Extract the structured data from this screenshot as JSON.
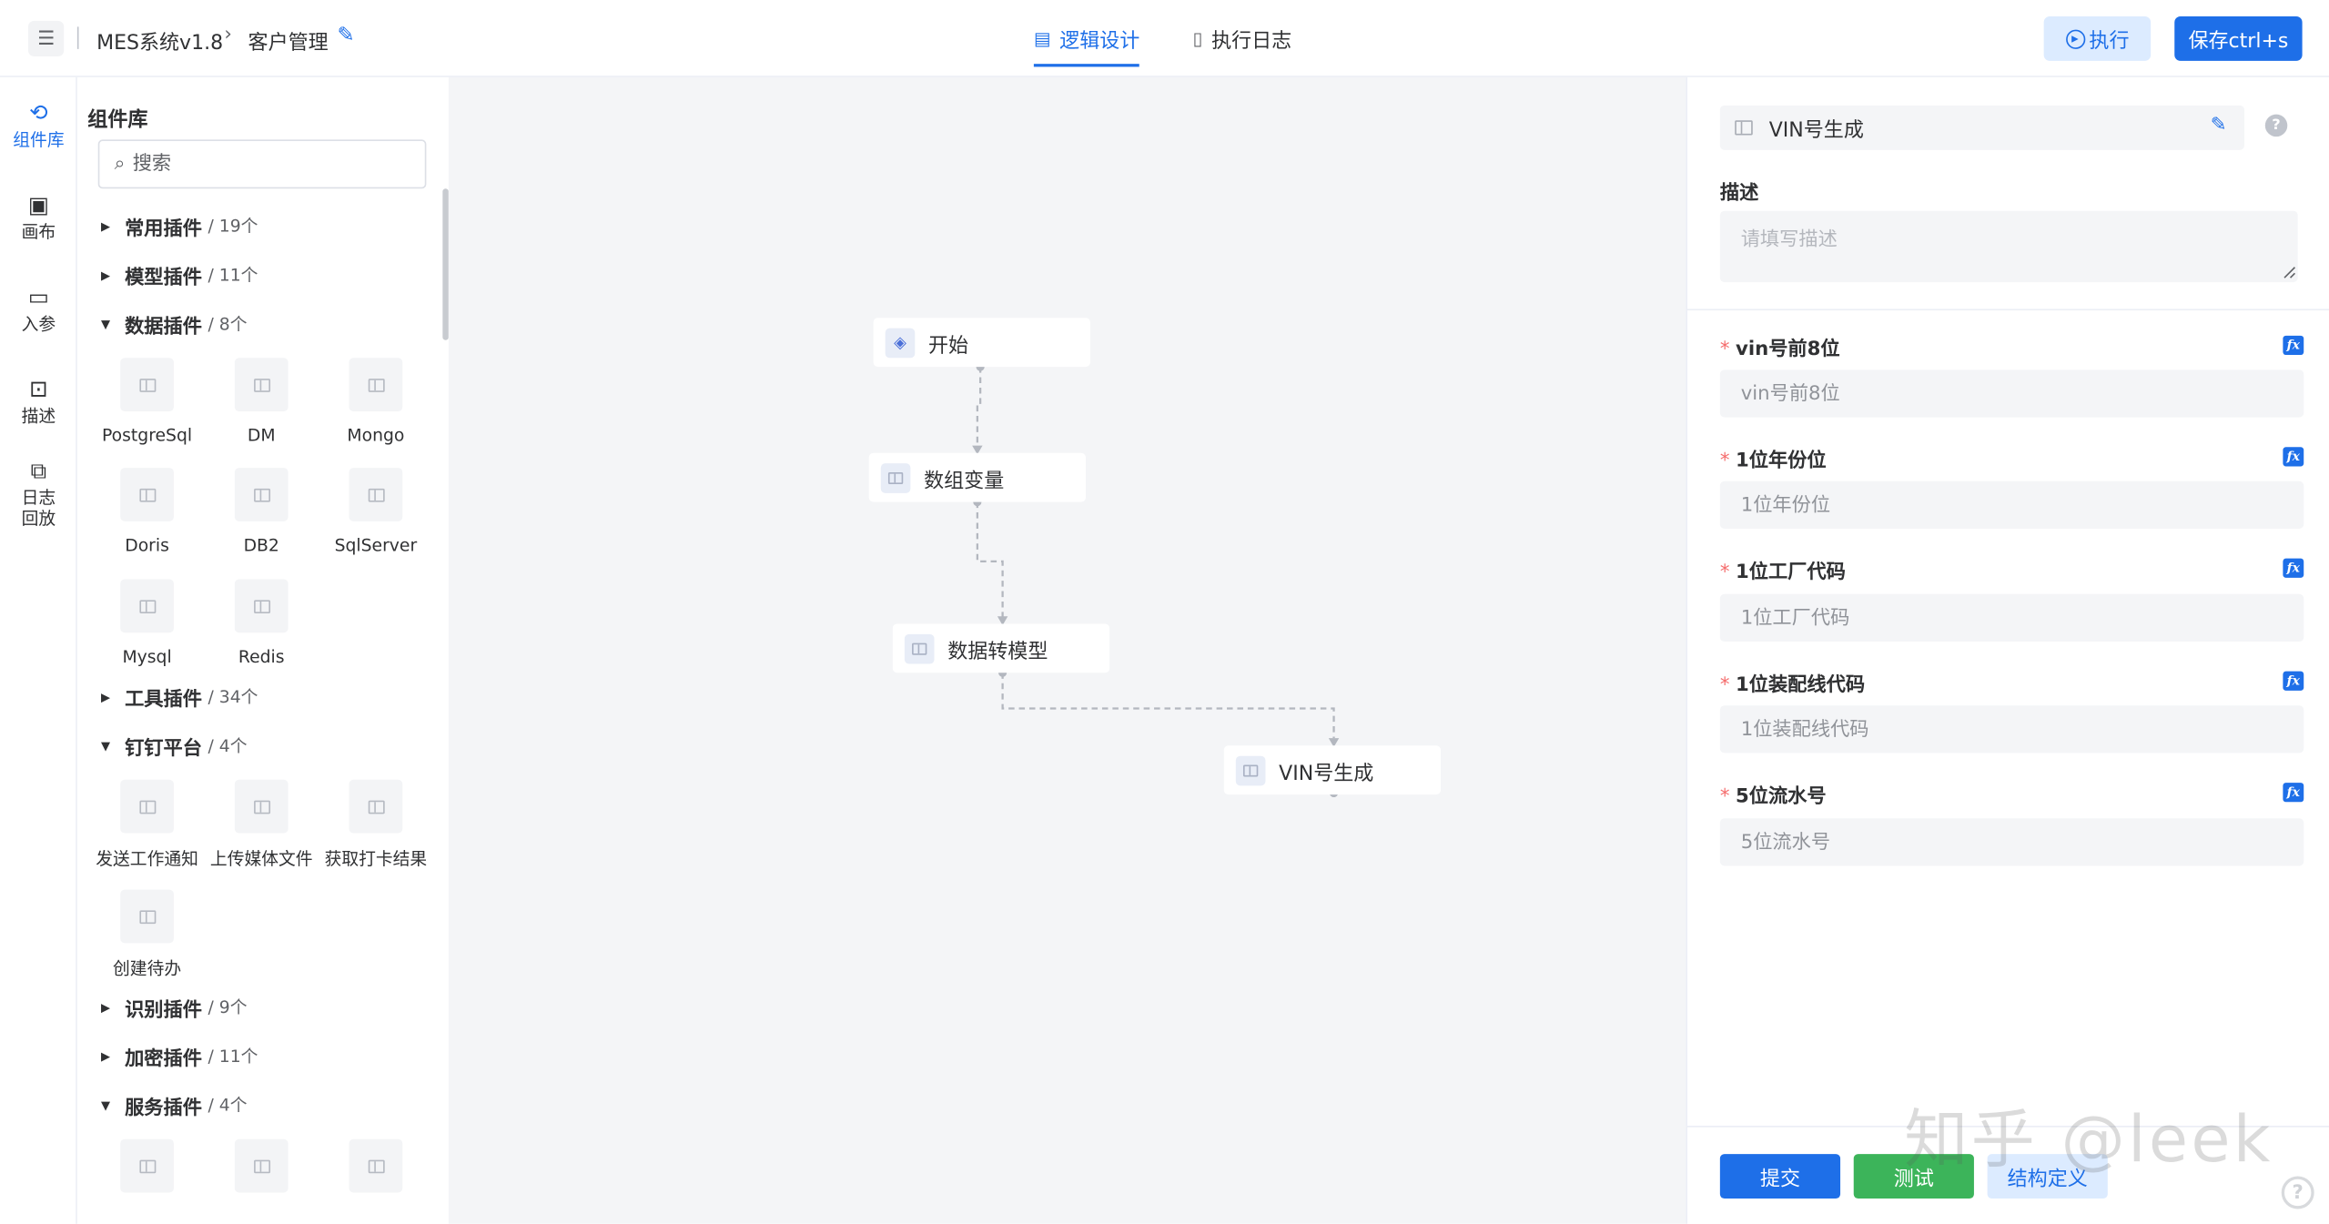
{
  "header": {
    "app_name": "MES系统v1.8",
    "breadcrumb_page": "客户管理",
    "tabs": [
      {
        "label": "逻辑设计",
        "active": true
      },
      {
        "label": "执行日志",
        "active": false
      }
    ],
    "execute_label": "执行",
    "save_label": "保存ctrl+s",
    "accent_color": "#1e6fe8"
  },
  "rail": {
    "items": [
      {
        "label": "组件库",
        "icon": "plugin-library-icon",
        "active": true
      },
      {
        "label": "画布",
        "icon": "canvas-icon",
        "active": false
      },
      {
        "label": "入参",
        "icon": "input-params-icon",
        "active": false
      },
      {
        "label": "描述",
        "icon": "description-icon",
        "active": false
      },
      {
        "label": "日志回放",
        "line1": "日志",
        "line2": "回放",
        "icon": "log-replay-icon",
        "active": false
      }
    ]
  },
  "library": {
    "title": "组件库",
    "search_placeholder": "搜索",
    "groups": [
      {
        "name": "常用插件",
        "count": "/ 19个",
        "expanded": false
      },
      {
        "name": "模型插件",
        "count": "/ 11个",
        "expanded": false
      },
      {
        "name": "数据插件",
        "count": "/ 8个",
        "expanded": true,
        "items": [
          "PostgreSql",
          "DM",
          "Mongo",
          "Doris",
          "DB2",
          "SqlServer",
          "Mysql",
          "Redis"
        ]
      },
      {
        "name": "工具插件",
        "count": "/ 34个",
        "expanded": false
      },
      {
        "name": "钉钉平台",
        "count": "/ 4个",
        "expanded": true,
        "items": [
          "发送工作通知",
          "上传媒体文件",
          "获取打卡结果",
          "创建待办"
        ]
      },
      {
        "name": "识别插件",
        "count": "/ 9个",
        "expanded": false
      },
      {
        "name": "加密插件",
        "count": "/ 11个",
        "expanded": false
      },
      {
        "name": "服务插件",
        "count": "/ 4个",
        "expanded": true
      }
    ]
  },
  "canvas": {
    "nodes": [
      {
        "label": "开始",
        "icon": "layers-icon"
      },
      {
        "label": "数组变量",
        "icon": "plugin-icon"
      },
      {
        "label": "数据转模型",
        "icon": "plugin-icon"
      },
      {
        "label": "VIN号生成",
        "icon": "plugin-icon"
      }
    ]
  },
  "panel": {
    "node_name": "VIN号生成",
    "description_label": "描述",
    "description_placeholder": "请填写描述",
    "fields": [
      {
        "label": "vin号前8位",
        "placeholder": "vin号前8位",
        "required": true
      },
      {
        "label": "1位年份位",
        "placeholder": "1位年份位",
        "required": true
      },
      {
        "label": "1位工厂代码",
        "placeholder": "1位工厂代码",
        "required": true
      },
      {
        "label": "1位装配线代码",
        "placeholder": "1位装配线代码",
        "required": true
      },
      {
        "label": "5位流水号",
        "placeholder": "5位流水号",
        "required": true
      }
    ],
    "required_mark": "*",
    "fx_label": "fx",
    "submit_label": "提交",
    "test_label": "测试",
    "struct_label": "结构定义"
  },
  "watermark": "知乎 @leek"
}
